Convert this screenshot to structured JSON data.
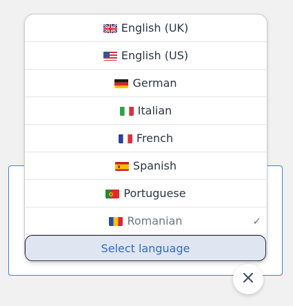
{
  "languages": [
    {
      "label": "English (UK)",
      "flag": "gb-flag-icon"
    },
    {
      "label": "English (US)",
      "flag": "us-flag-icon"
    },
    {
      "label": "German",
      "flag": "de-flag-icon"
    },
    {
      "label": "Italian",
      "flag": "it-flag-icon"
    },
    {
      "label": "French",
      "flag": "fr-flag-icon"
    },
    {
      "label": "Spanish",
      "flag": "es-flag-icon"
    },
    {
      "label": "Portuguese",
      "flag": "pt-flag-icon"
    },
    {
      "label": "Romanian",
      "flag": "ro-flag-icon",
      "selected": true
    }
  ],
  "check_mark": "✓",
  "select_button_label": "Select language",
  "close_icon": "close-icon",
  "colors": {
    "accent": "#2f6cc4",
    "card_border": "#3f7fcf",
    "select_bg": "#dfe5f1"
  }
}
